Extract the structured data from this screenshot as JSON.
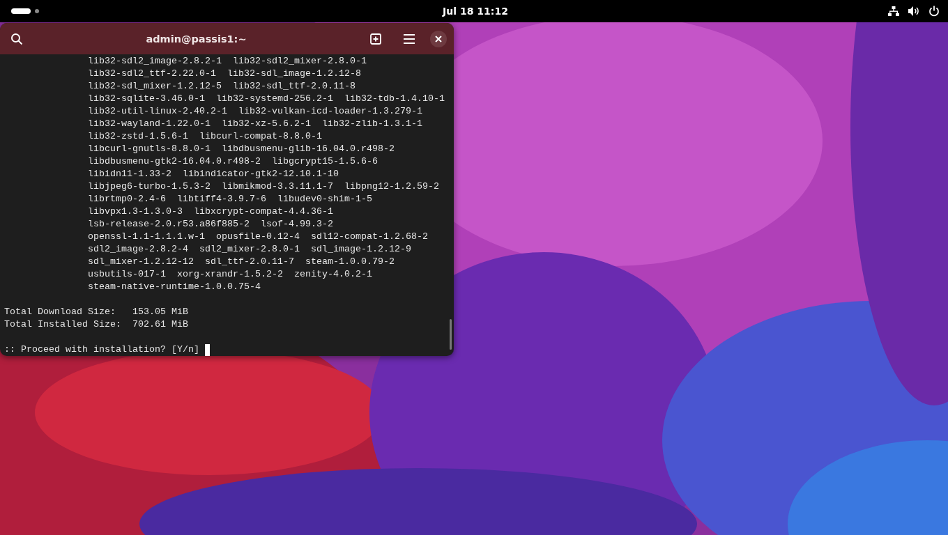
{
  "top_bar": {
    "clock": "Jul 18 11:12"
  },
  "terminal": {
    "title": "admin@passis1:~",
    "package_lines": [
      "lib32-sdl2_image-2.8.2-1  lib32-sdl2_mixer-2.8.0-1",
      "lib32-sdl2_ttf-2.22.0-1  lib32-sdl_image-1.2.12-8",
      "lib32-sdl_mixer-1.2.12-5  lib32-sdl_ttf-2.0.11-8",
      "lib32-sqlite-3.46.0-1  lib32-systemd-256.2-1  lib32-tdb-1.4.10-1",
      "lib32-util-linux-2.40.2-1  lib32-vulkan-icd-loader-1.3.279-1",
      "lib32-wayland-1.22.0-1  lib32-xz-5.6.2-1  lib32-zlib-1.3.1-1",
      "lib32-zstd-1.5.6-1  libcurl-compat-8.8.0-1",
      "libcurl-gnutls-8.8.0-1  libdbusmenu-glib-16.04.0.r498-2",
      "libdbusmenu-gtk2-16.04.0.r498-2  libgcrypt15-1.5.6-6",
      "libidn11-1.33-2  libindicator-gtk2-12.10.1-10",
      "libjpeg6-turbo-1.5.3-2  libmikmod-3.3.11.1-7  libpng12-1.2.59-2",
      "librtmp0-2.4-6  libtiff4-3.9.7-6  libudev0-shim-1-5",
      "libvpx1.3-1.3.0-3  libxcrypt-compat-4.4.36-1",
      "lsb-release-2.0.r53.a86f885-2  lsof-4.99.3-2",
      "openssl-1.1-1.1.1.w-1  opusfile-0.12-4  sdl12-compat-1.2.68-2",
      "sdl2_image-2.8.2-4  sdl2_mixer-2.8.0-1  sdl_image-1.2.12-9",
      "sdl_mixer-1.2.12-12  sdl_ttf-2.0.11-7  steam-1.0.0.79-2",
      "usbutils-017-1  xorg-xrandr-1.5.2-2  zenity-4.0.2-1",
      "steam-native-runtime-1.0.0.75-4"
    ],
    "summary_lines": [
      "Total Download Size:   153.05 MiB",
      "Total Installed Size:  702.61 MiB"
    ],
    "prompt": ":: Proceed with installation? [Y/n]"
  }
}
